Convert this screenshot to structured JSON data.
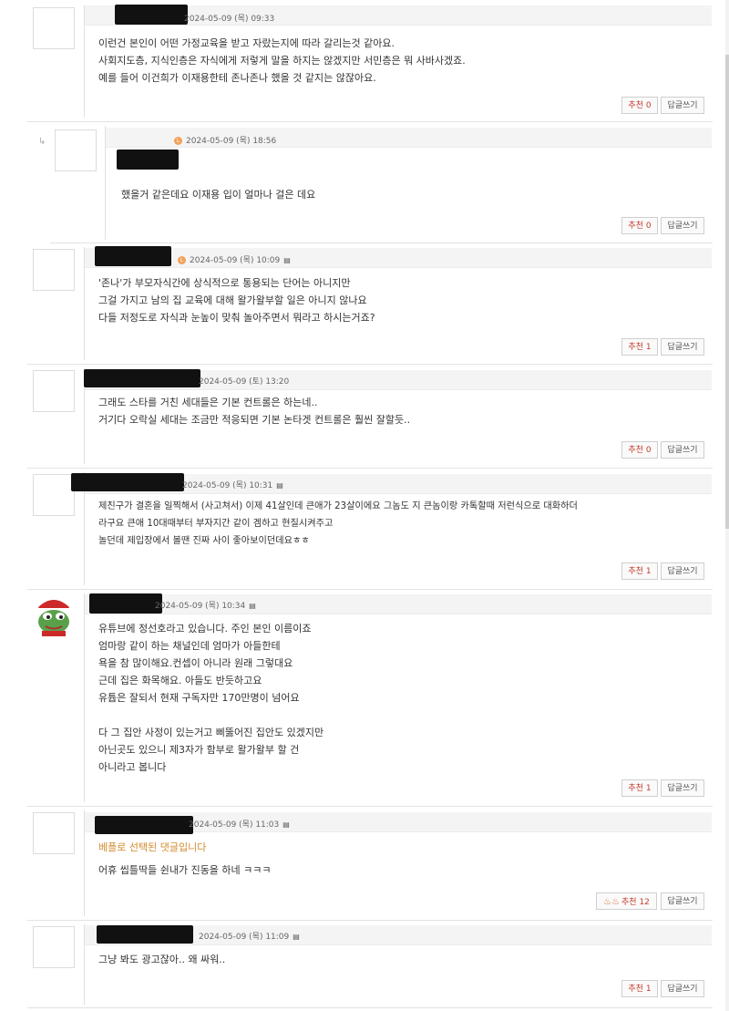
{
  "comments": [
    {
      "date": "2024-05-09 (목) 09:33",
      "lines": [
        "이런건 본인이 어떤 가정교육을 받고 자랐는지에 따라 갈리는것 같아요.",
        "사회지도층, 지식인층은 자식에게 저렇게 말을 하지는 않겠지만 서민층은 뭐 사바사겠죠.",
        "예를 들어 이건희가 이재용한테 존나존나 했을 것 같지는 않잖아요."
      ],
      "like_label": "추천 0",
      "reply_label": "답글쓰기"
    },
    {
      "date": "2024-05-09 (목) 18:56",
      "lines": [
        "했을거 같은데요 이재용 입이 얼마나 걸은 데요"
      ],
      "like_label": "추천 0",
      "reply_label": "답글쓰기"
    },
    {
      "date": "2024-05-09 (목) 10:09",
      "lines": [
        "'존나'가 부모자식간에 상식적으로 통용되는 단어는 아니지만",
        "그걸 가지고 남의 집 교육에 대해 왈가왈부할 일은 아니지 않나요",
        "다들 저정도로 자식과 눈높이 맞춰 놀아주면서 뭐라고 하시는거죠?"
      ],
      "like_label": "추천 1",
      "reply_label": "답글쓰기"
    },
    {
      "date": "2024-05-09 (토) 13:20",
      "lines": [
        "그래도 스타를 거친 세대들은 기본 컨트롤은 하는네..",
        "거기다 오락실 세대는 조금만 적응되면 기본 논타겟 컨트롤은 훨씬 잘할듯.."
      ],
      "like_label": "추천 0",
      "reply_label": "답글쓰기"
    },
    {
      "date": "2024-05-09 (목) 10:31",
      "lines": [
        "제친구가 결혼을 일찍해서 (사고쳐서) 이제 41살인데 큰애가 23살이에요 그놈도 지 큰놈이랑 카톡할때 저런식으로 대화하더",
        "라구요 큰애 10대때부터 부자지간 같이 겜하고 현질시켜주고",
        "놀던데 제입장에서 볼땐 진짜 사이 좋아보이던데요ㅎㅎ"
      ],
      "like_label": "추천 1",
      "reply_label": "답글쓰기"
    },
    {
      "date": "2024-05-09 (목) 10:34",
      "lines": [
        "유튜브에 정선호라고 있습니다. 주인 본인 이름이죠",
        "엄마랑 같이 하는 채널인데 엄마가 아들한테",
        "욕을 참 많이해요.컨셉이 아니라 원래 그렇대요",
        "근데 집은 화목해요. 아들도 반듯하고요",
        "유튭은 잘되서 현재 구독자만 170만명이 넘어요",
        "",
        "다 그 집안 사정이 있는거고 삐뚫어진 집안도 있겠지만",
        "아닌곳도 있으니 제3자가 함부로 왈가왈부 할 건",
        "아니라고 봅니다"
      ],
      "like_label": "추천 1",
      "reply_label": "답글쓰기"
    },
    {
      "date": "2024-05-09 (목) 11:03",
      "best_label": "베플로 선택된 댓글입니다",
      "lines": [
        "어휴 씹틀딱들 쉰내가 진동을 하네 ㅋㅋㅋ"
      ],
      "like_label": "추천 12",
      "reply_label": "답글쓰기"
    },
    {
      "date": "2024-05-09 (목) 11:09",
      "lines": [
        "그냥 봐도 광고잖아.. 왜 싸워.."
      ],
      "like_label": "추천 1",
      "reply_label": "답글쓰기"
    }
  ],
  "icons": {
    "doc": "document-icon",
    "reply": "reply-arrow-icon",
    "level": "level-badge-icon",
    "best": "best-heart-icon",
    "avatar_special": "frog-avatar-icon"
  },
  "colors": {
    "like_text": "#c63b2c",
    "best_label": "#d48a2b",
    "redaction": "#111111"
  }
}
